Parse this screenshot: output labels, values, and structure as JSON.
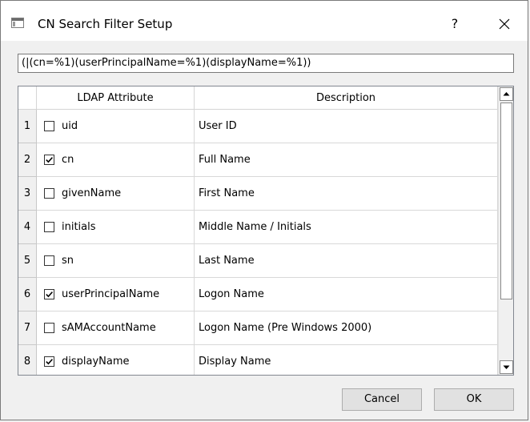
{
  "window": {
    "title": "CN Search Filter Setup",
    "help_label": "?"
  },
  "filter": {
    "value": "(|(cn=%1)(userPrincipalName=%1)(displayName=%1))"
  },
  "table": {
    "columns": [
      "LDAP Attribute",
      "Description"
    ],
    "rows": [
      {
        "num": "1",
        "attribute": "uid",
        "description": "User ID",
        "checked": false
      },
      {
        "num": "2",
        "attribute": "cn",
        "description": "Full Name",
        "checked": true
      },
      {
        "num": "3",
        "attribute": "givenName",
        "description": "First Name",
        "checked": false
      },
      {
        "num": "4",
        "attribute": "initials",
        "description": "Middle Name / Initials",
        "checked": false
      },
      {
        "num": "5",
        "attribute": "sn",
        "description": "Last Name",
        "checked": false
      },
      {
        "num": "6",
        "attribute": "userPrincipalName",
        "description": "Logon Name",
        "checked": true
      },
      {
        "num": "7",
        "attribute": "sAMAccountName",
        "description": "Logon Name (Pre Windows 2000)",
        "checked": false
      },
      {
        "num": "8",
        "attribute": "displayName",
        "description": "Display Name",
        "checked": true
      }
    ]
  },
  "buttons": {
    "cancel": "Cancel",
    "ok": "OK"
  }
}
